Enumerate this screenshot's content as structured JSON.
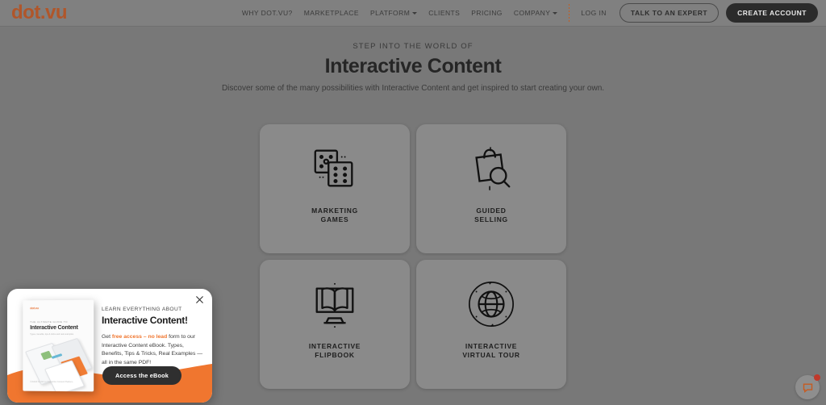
{
  "header": {
    "logo": "dot.vu",
    "nav_items": [
      {
        "label": "WHY DOT.VU?",
        "has_caret": false
      },
      {
        "label": "MARKETPLACE",
        "has_caret": false
      },
      {
        "label": "PLATFORM",
        "has_caret": true
      },
      {
        "label": "CLIENTS",
        "has_caret": false
      },
      {
        "label": "PRICING",
        "has_caret": false
      },
      {
        "label": "COMPANY",
        "has_caret": true
      }
    ],
    "login_label": "LOG IN",
    "expert_button": "TALK TO AN EXPERT",
    "create_account_button": "CREATE ACCOUNT",
    "accent_color": "#c45d21"
  },
  "hero": {
    "eyebrow": "STEP INTO THE WORLD OF",
    "title": "Interactive Content",
    "subtitle": "Discover some of the many possibilities with Interactive Content and get inspired to start creating your own."
  },
  "cards": [
    {
      "label": "MARKETING\nGAMES",
      "icon": "dice-icon"
    },
    {
      "label": "GUIDED\nSELLING",
      "icon": "shopping-bag-magnifier-icon"
    },
    {
      "label": "INTERACTIVE\nFLIPBOOK",
      "icon": "book-on-monitor-icon"
    },
    {
      "label": "INTERACTIVE\nVIRTUAL TOUR",
      "icon": "globe-orbit-icon"
    }
  ],
  "popup": {
    "kicker": "LEARN EVERYTHING ABOUT",
    "title": "Interactive Content!",
    "body_before": "Get ",
    "body_highlight": "free access – no lead",
    "body_after": " form to our Interactive Content eBook. Types, Benefits, Tips & Tricks, Real Examples — all in the same PDF!",
    "cta": "Access the eBook",
    "close_icon": "close-icon",
    "accent_color": "#f0762f",
    "ebook_cover": {
      "logo": "dot.vu",
      "kicker": "THE ULTIMATE GUIDE TO",
      "title": "Interactive Content",
      "subtitle": "Types, benefits, tips & tricks and real examples",
      "footer": "Created by dot.vu\nInteractive Content Platform"
    }
  },
  "chat_widget": {
    "icon": "chat-bubble-icon",
    "badge": "",
    "accent_color": "#c85a1e"
  }
}
